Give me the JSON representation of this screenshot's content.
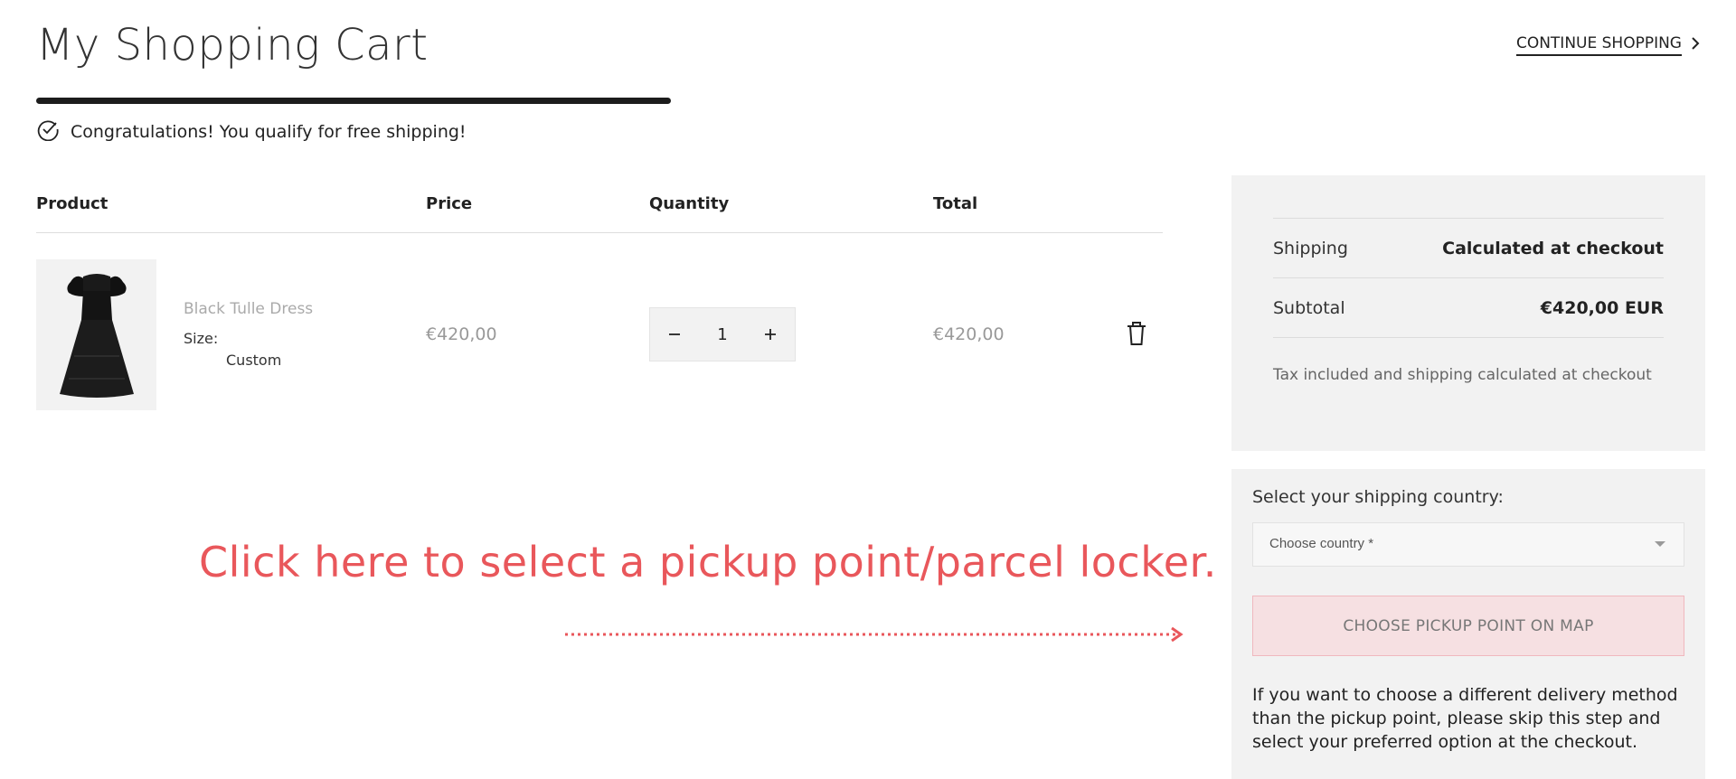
{
  "header": {
    "title": "My Shopping Cart",
    "continue_label": "CONTINUE SHOPPING"
  },
  "shipping_banner": {
    "message": "Congratulations! You qualify for free shipping!",
    "progress": 1.0
  },
  "table": {
    "columns": [
      "Product",
      "Price",
      "Quantity",
      "Total"
    ]
  },
  "cart_items": [
    {
      "name": "Black Tulle Dress",
      "size_label": "Size:",
      "size_value": "Custom",
      "price": "€420,00",
      "quantity": "1",
      "total": "€420,00",
      "image_icon": "dress-icon"
    }
  ],
  "summary": {
    "shipping_label": "Shipping",
    "shipping_value": "Calculated at checkout",
    "subtotal_label": "Subtotal",
    "subtotal_value": "€420,00 EUR",
    "tax_note": "Tax included and shipping calculated at checkout"
  },
  "shipping_selector": {
    "label": "Select your shipping country:",
    "country_placeholder": "Choose country *",
    "pickup_button": "CHOOSE PICKUP POINT ON MAP",
    "alt_note": "If you want to choose a different delivery method than the pickup point, please skip this step and select your preferred option at the checkout."
  },
  "hint": {
    "text": "Click here to select a pickup point/parcel locker."
  },
  "colors": {
    "accent_red": "#e9575b",
    "panel_bg": "#f2f2f2",
    "pickup_bg": "#f6e0e2"
  }
}
